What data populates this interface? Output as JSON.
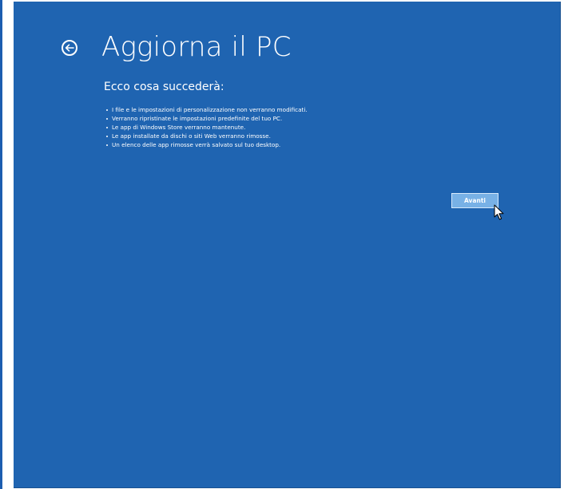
{
  "header": {
    "back_icon": "back-arrow-icon",
    "title": "Aggiorna il PC"
  },
  "main": {
    "subtitle": "Ecco cosa succederà:",
    "bullets": [
      "I file e le impostazioni di personalizzazione non verranno modificati.",
      "Verranno ripristinate le impostazioni predefinite del tuo PC.",
      "Le app di Windows Store verranno mantenute.",
      "Le app installate da dischi o siti Web verranno rimosse.",
      "Un elenco delle app rimosse verrà salvato sul tuo desktop."
    ]
  },
  "actions": {
    "next_label": "Avanti"
  },
  "colors": {
    "background": "#1f64b1",
    "button_fill": "#78b1e6",
    "text": "#ffffff"
  }
}
